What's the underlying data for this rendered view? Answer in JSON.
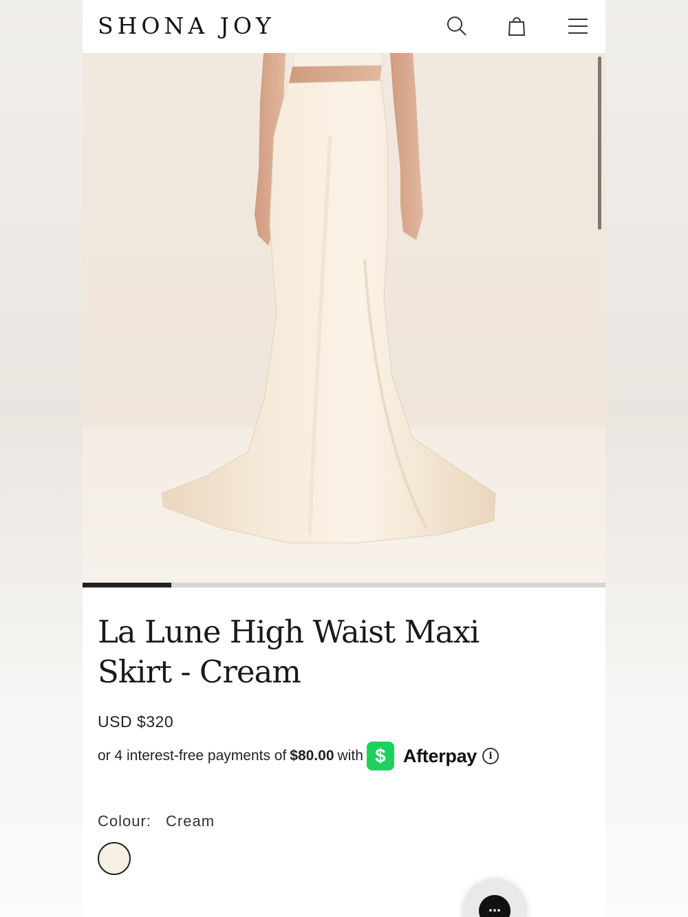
{
  "header": {
    "logo": "SHONA JOY",
    "icons": [
      "search-icon",
      "bag-icon",
      "menu-icon"
    ]
  },
  "gallery": {
    "progress": 0.17
  },
  "product": {
    "title": "La Lune High Waist Maxi Skirt - Cream",
    "price": "USD $320",
    "installment_prefix": "or 4 interest-free payments of",
    "installment_amount": "$80.00",
    "installment_with": "with",
    "cash_symbol": "$",
    "afterpay_label": "Afterpay",
    "info_symbol": "i",
    "colour_label": "Colour:",
    "colour_value": "Cream",
    "swatch_color": "#f8f0e3"
  },
  "chat": {
    "symbol": "..."
  }
}
